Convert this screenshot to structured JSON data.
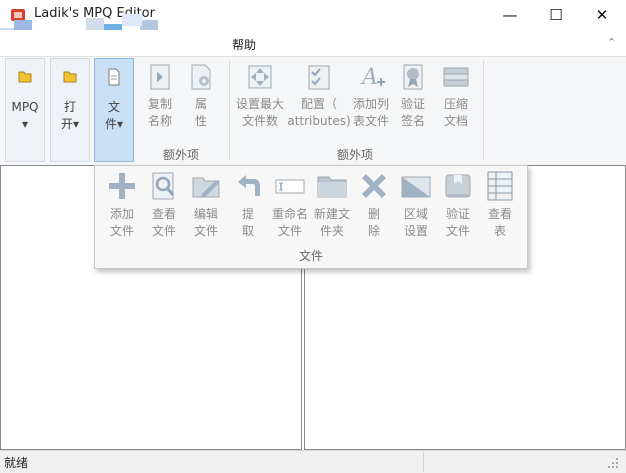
{
  "window": {
    "title": "Ladik's MPQ Editor",
    "min_glyph": "—",
    "max_glyph": "☐",
    "close_glyph": "✕"
  },
  "menu": {
    "help": "帮助",
    "collapse": "⌃"
  },
  "ribbon": {
    "buttons": [
      {
        "label1": "MPQ",
        "label2": "▾"
      },
      {
        "label1": "打",
        "label2": "开▾"
      },
      {
        "label1": "文",
        "label2": "件▾"
      },
      {
        "label1": "复制",
        "label2": "名称"
      },
      {
        "label1": "属",
        "label2": "性"
      },
      {
        "label1": "设置最大",
        "label2": "文件数"
      },
      {
        "label1": "配置（",
        "label2": "attributes)"
      },
      {
        "label1": "添加列",
        "label2": "表文件"
      },
      {
        "label1": "验证",
        "label2": "签名"
      },
      {
        "label1": "压缩",
        "label2": "文档"
      }
    ],
    "group1": "额外项",
    "group2": "额外项"
  },
  "dropdown": {
    "items": [
      {
        "label1": "添加",
        "label2": "文件"
      },
      {
        "label1": "查看",
        "label2": "文件"
      },
      {
        "label1": "编辑",
        "label2": "文件"
      },
      {
        "label1": "提",
        "label2": "取"
      },
      {
        "label1": "重命名",
        "label2": "文件"
      },
      {
        "label1": "新建文",
        "label2": "件夹"
      },
      {
        "label1": "删",
        "label2": "除"
      },
      {
        "label1": "区域",
        "label2": "设置"
      },
      {
        "label1": "验证",
        "label2": "文件"
      },
      {
        "label1": "查看",
        "label2": "表"
      }
    ],
    "group": "文件"
  },
  "status": {
    "text": "就绪"
  }
}
